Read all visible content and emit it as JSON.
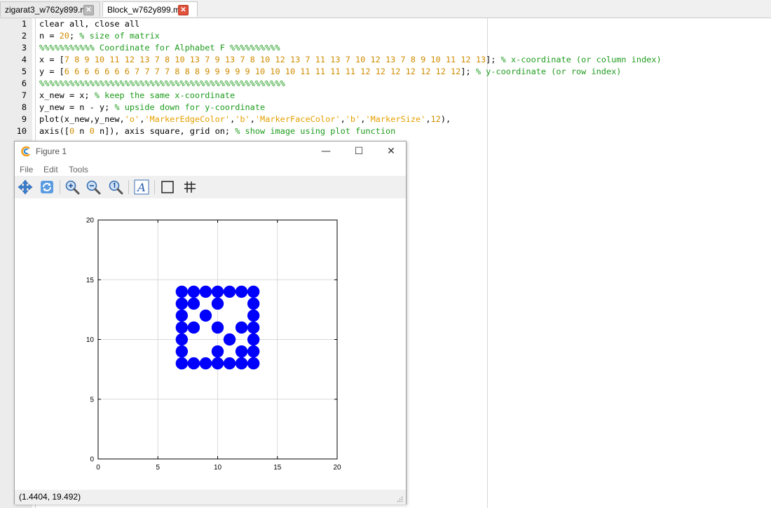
{
  "tabs": [
    {
      "label": "zigarat3_w762y899.m",
      "active": false
    },
    {
      "label": "Block_w762y899.m",
      "active": true
    }
  ],
  "code": {
    "lines": [
      {
        "num": "1",
        "segs": [
          {
            "t": "clear all, close all",
            "c": ""
          }
        ]
      },
      {
        "num": "2",
        "segs": [
          {
            "t": "n = ",
            "c": ""
          },
          {
            "t": "20",
            "c": "n"
          },
          {
            "t": "; ",
            "c": ""
          },
          {
            "t": "% size of matrix",
            "c": "c"
          }
        ]
      },
      {
        "num": "3",
        "segs": [
          {
            "t": "%%%%%%%%%%% Coordinate for Alphabet F %%%%%%%%%%",
            "c": "c"
          }
        ]
      },
      {
        "num": "4",
        "segs": [
          {
            "t": "x = [",
            "c": ""
          },
          {
            "t": "7 8 9 10 11 12 13 7 8 10 13 7 9 13 7 8 10 12 13 7 11 13 7 10 12 13 7 8 9 10 11 12 13",
            "c": "n"
          },
          {
            "t": "]; ",
            "c": ""
          },
          {
            "t": "% x-coordinate (or column index)",
            "c": "c"
          }
        ]
      },
      {
        "num": "5",
        "segs": [
          {
            "t": "y = [",
            "c": ""
          },
          {
            "t": "6 6 6 6 6 6 6 7 7 7 7 8 8 8 9 9 9 9 9 10 10 10 11 11 11 11 12 12 12 12 12 12 12",
            "c": "n"
          },
          {
            "t": "]; ",
            "c": ""
          },
          {
            "t": "% y-coordinate (or row index)",
            "c": "c"
          }
        ]
      },
      {
        "num": "6",
        "segs": [
          {
            "t": "%%%%%%%%%%%%%%%%%%%%%%%%%%%%%%%%%%%%%%%%%%%%%%%%%",
            "c": "c"
          }
        ]
      },
      {
        "num": "7",
        "segs": [
          {
            "t": "x_new = x; ",
            "c": ""
          },
          {
            "t": "% keep the same x-coordinate",
            "c": "c"
          }
        ]
      },
      {
        "num": "8",
        "segs": [
          {
            "t": "y_new = n - y; ",
            "c": ""
          },
          {
            "t": "% upside down for y-coordinate",
            "c": "c"
          }
        ]
      },
      {
        "num": "9",
        "segs": [
          {
            "t": "plot(x_new,y_new,",
            "c": ""
          },
          {
            "t": "'o'",
            "c": "s"
          },
          {
            "t": ",",
            "c": ""
          },
          {
            "t": "'MarkerEdgeColor'",
            "c": "s"
          },
          {
            "t": ",",
            "c": ""
          },
          {
            "t": "'b'",
            "c": "s"
          },
          {
            "t": ",",
            "c": ""
          },
          {
            "t": "'MarkerFaceColor'",
            "c": "s"
          },
          {
            "t": ",",
            "c": ""
          },
          {
            "t": "'b'",
            "c": "s"
          },
          {
            "t": ",",
            "c": ""
          },
          {
            "t": "'MarkerSize'",
            "c": "s"
          },
          {
            "t": ",",
            "c": ""
          },
          {
            "t": "12",
            "c": "n"
          },
          {
            "t": "),",
            "c": ""
          }
        ]
      },
      {
        "num": "10",
        "segs": [
          {
            "t": "axis([",
            "c": ""
          },
          {
            "t": "0",
            "c": "n"
          },
          {
            "t": " n ",
            "c": ""
          },
          {
            "t": "0",
            "c": "n"
          },
          {
            "t": " n]), axis square, grid on; ",
            "c": ""
          },
          {
            "t": "% show image using plot function",
            "c": "c"
          }
        ]
      }
    ]
  },
  "figure": {
    "title": "Figure 1",
    "menus": [
      "File",
      "Edit",
      "Tools"
    ],
    "tools": [
      "pan-icon",
      "rotate-icon",
      "zoom-in-icon",
      "zoom-out-icon",
      "zoom-reset-icon",
      "text-icon",
      "box-icon",
      "grid-icon"
    ],
    "status": "(1.4404, 19.492)"
  },
  "colors": {
    "marker": "#0000ff",
    "comment": "#1e9b1e",
    "number": "#d08c00",
    "string": "#e6a000",
    "close_active": "#e0523c"
  },
  "chart_data": {
    "type": "scatter",
    "x": [
      7,
      8,
      9,
      10,
      11,
      12,
      13,
      7,
      8,
      10,
      13,
      7,
      9,
      13,
      7,
      8,
      10,
      12,
      13,
      7,
      11,
      13,
      7,
      10,
      12,
      13,
      7,
      8,
      9,
      10,
      11,
      12,
      13
    ],
    "y": [
      14,
      14,
      14,
      14,
      14,
      14,
      14,
      13,
      13,
      13,
      13,
      12,
      12,
      12,
      11,
      11,
      11,
      11,
      11,
      10,
      10,
      10,
      9,
      9,
      9,
      9,
      8,
      8,
      8,
      8,
      8,
      8,
      8
    ],
    "xlim": [
      0,
      20
    ],
    "ylim": [
      0,
      20
    ],
    "xticks": [
      "0",
      "5",
      "10",
      "15",
      "20"
    ],
    "yticks": [
      "0",
      "5",
      "10",
      "15",
      "20"
    ],
    "xtick_values": [
      0,
      5,
      10,
      15,
      20
    ],
    "ytick_values": [
      0,
      5,
      10,
      15,
      20
    ],
    "grid": true,
    "marker": "o",
    "marker_color": "#0000ff"
  }
}
